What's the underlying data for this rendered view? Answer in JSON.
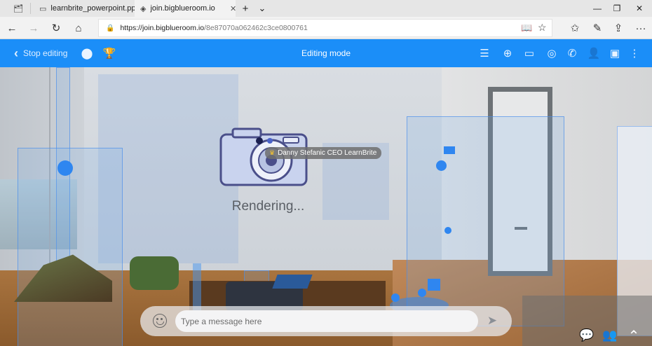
{
  "browser": {
    "tabs": [
      {
        "label": "learnbrite_powerpoint.ppt"
      },
      {
        "label": "join.bigblueroom.io"
      }
    ],
    "new_tab": "+",
    "tab_menu": "⌄",
    "window_buttons": {
      "minimize": "—",
      "maximize": "❐",
      "close": "✕"
    },
    "url_host": "https://join.bigblueroom.io",
    "url_path": "/8e87070a062462c3ce0800761"
  },
  "toolbar": {
    "stop_editing": "Stop editing",
    "title": "Editing mode",
    "icons": [
      "edit-list-icon",
      "add-location-icon",
      "add-screen-icon",
      "remove-target-icon",
      "phone-icon",
      "add-user-icon",
      "vr-headset-icon",
      "more-icon"
    ],
    "accent": "#1b8ef8"
  },
  "scene": {
    "rendering_label": "Rendering...",
    "user_name": "Danny Stefanic CEO LearnBrite"
  },
  "chat": {
    "placeholder": "Type a message here"
  }
}
